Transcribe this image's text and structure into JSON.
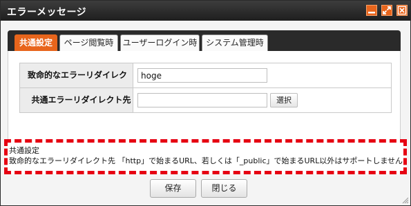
{
  "window": {
    "title": "エラーメッセージ",
    "controls": [
      "minimize-icon",
      "maximize-icon",
      "close-icon"
    ],
    "accent_color": "#e8651c"
  },
  "tabs": [
    {
      "label": "共通設定",
      "active": true
    },
    {
      "label": "ページ閲覧時",
      "active": false
    },
    {
      "label": "ユーザーログイン時",
      "active": false
    },
    {
      "label": "システム管理時",
      "active": false
    }
  ],
  "form": {
    "rows": [
      {
        "label": "致命的なエラーリダイレクト先",
        "value": "hoge",
        "placeholder": ""
      },
      {
        "label": "共通エラーリダイレクト先",
        "value": "",
        "placeholder": "",
        "button": "選択"
      }
    ]
  },
  "notice": {
    "title": "共通設定",
    "body": "致命的なエラーリダイレクト先 「http」で始まるURL、若しくは「_public」で始まるURL以外はサポートしません",
    "highlight_color": "#e60012"
  },
  "footer": {
    "save_label": "保存",
    "close_label": "閉じる"
  }
}
